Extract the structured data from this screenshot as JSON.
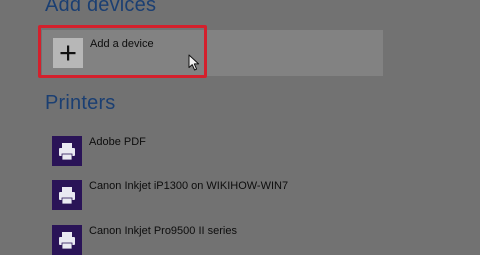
{
  "add_devices": {
    "heading": "Add devices",
    "add_button_label": "Add a device"
  },
  "printers": {
    "heading": "Printers",
    "items": [
      {
        "label": "Adobe PDF"
      },
      {
        "label": "Canon Inkjet iP1300 on WIKIHOW-WIN7"
      },
      {
        "label": "Canon Inkjet Pro9500 II series"
      }
    ]
  },
  "colors": {
    "background": "#727272",
    "heading": "#1b3f72",
    "highlight": "#d4202c",
    "printer_tile": "#2a1457"
  },
  "icons": {
    "add": "plus-icon",
    "printer": "printer-icon",
    "cursor": "mouse-cursor-icon"
  }
}
